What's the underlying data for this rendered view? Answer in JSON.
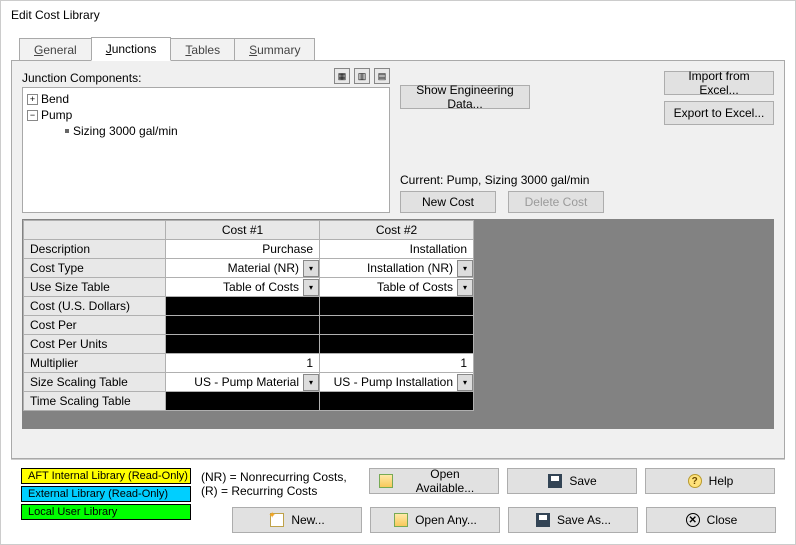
{
  "window": {
    "title": "Edit Cost Library"
  },
  "tabs": {
    "general": "General",
    "junctions": "Junctions",
    "tables": "Tables",
    "summary": "Summary"
  },
  "panel": {
    "components_label": "Junction Components:",
    "tree": {
      "bend": "Bend",
      "pump": "Pump",
      "pump_child": "Sizing 3000 gal/min"
    },
    "show_eng_data": "Show Engineering Data...",
    "import_excel": "Import from Excel...",
    "export_excel": "Export to Excel...",
    "current_label": "Current: Pump, Sizing 3000 gal/min",
    "new_cost": "New Cost",
    "delete_cost": "Delete Cost"
  },
  "table": {
    "col1": "Cost #1",
    "col2": "Cost #2",
    "rows": {
      "description": {
        "label": "Description",
        "v1": "Purchase",
        "v2": "Installation"
      },
      "cost_type": {
        "label": "Cost Type",
        "v1": "Material (NR)",
        "v2": "Installation (NR)"
      },
      "use_size": {
        "label": "Use Size Table",
        "v1": "Table of Costs",
        "v2": "Table of Costs"
      },
      "cost_usd": {
        "label": "Cost (U.S. Dollars)"
      },
      "cost_per": {
        "label": "Cost Per"
      },
      "cost_per_units": {
        "label": "Cost Per Units"
      },
      "multiplier": {
        "label": "Multiplier",
        "v1": "1",
        "v2": "1"
      },
      "size_scaling": {
        "label": "Size Scaling Table",
        "v1": "US - Pump Material",
        "v2": "US - Pump Installation"
      },
      "time_scaling": {
        "label": "Time Scaling Table"
      }
    }
  },
  "footer": {
    "legend": {
      "internal": "AFT Internal Library (Read-Only)",
      "external": "External Library (Read-Only)",
      "local": "Local User Library"
    },
    "note": "(NR) = Nonrecurring Costs, (R) = Recurring Costs",
    "buttons": {
      "open_available": "Open Available...",
      "save": "Save",
      "help": "Help",
      "new": "New...",
      "open_any": "Open Any...",
      "save_as": "Save As...",
      "close": "Close"
    }
  }
}
